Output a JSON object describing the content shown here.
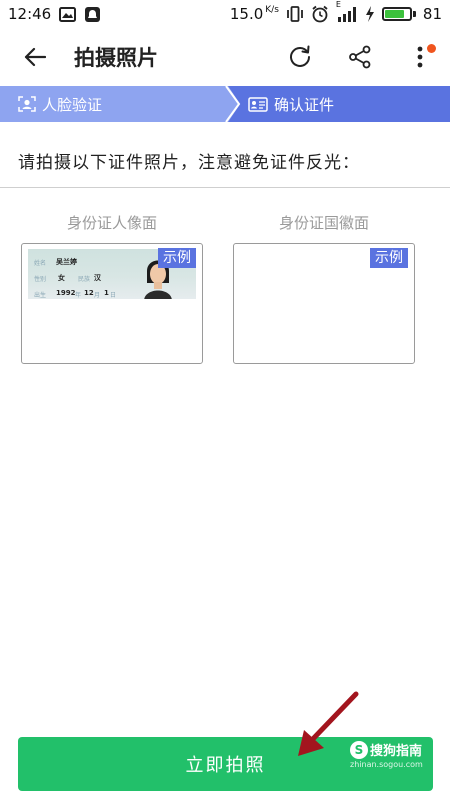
{
  "status_bar": {
    "time": "12:46",
    "speed": "15.0",
    "speed_unit": "K/s",
    "network_type": "E",
    "battery_percent": "81",
    "battery_level": 0.81,
    "icons": [
      "image-notification-icon",
      "chat-notification-icon",
      "vibrate-icon",
      "alarm-icon",
      "signal-icon",
      "charging-icon",
      "battery-icon"
    ]
  },
  "app_bar": {
    "title": "拍摄照片",
    "icons": [
      "back-arrow-icon",
      "refresh-icon",
      "share-icon",
      "more-icon"
    ]
  },
  "steps": [
    {
      "label": "人脸验证",
      "icon": "face-scan-icon",
      "status": "completed"
    },
    {
      "label": "确认证件",
      "icon": "id-card-icon",
      "status": "active"
    }
  ],
  "colors": {
    "step_completed": "#8ea4f0",
    "step_active": "#5a73e0",
    "primary_button": "#22c06a",
    "example_tag": "#5a73e0",
    "annotation_arrow": "#a3151e"
  },
  "instruction": "请拍摄以下证件照片，注意避免证件反光：",
  "cards": [
    {
      "title": "身份证人像面",
      "example_tag": "示例",
      "sample": {
        "name_label": "姓名",
        "name_value": "吴兰婷",
        "sex_label": "性别",
        "sex_value": "女",
        "ethnicity_label": "民族",
        "ethnicity_value": "汉",
        "birth_label": "出生",
        "birth_year": "1992",
        "birth_year_unit": "年",
        "birth_month": "12",
        "birth_month_unit": "月",
        "birth_day": "1",
        "birth_day_unit": "日"
      }
    },
    {
      "title": "身份证国徽面",
      "example_tag": "示例"
    }
  ],
  "primary_button": "立即拍照",
  "watermark": {
    "logo": "S",
    "text": "搜狗指南",
    "url": "zhinan.sogou.com"
  }
}
